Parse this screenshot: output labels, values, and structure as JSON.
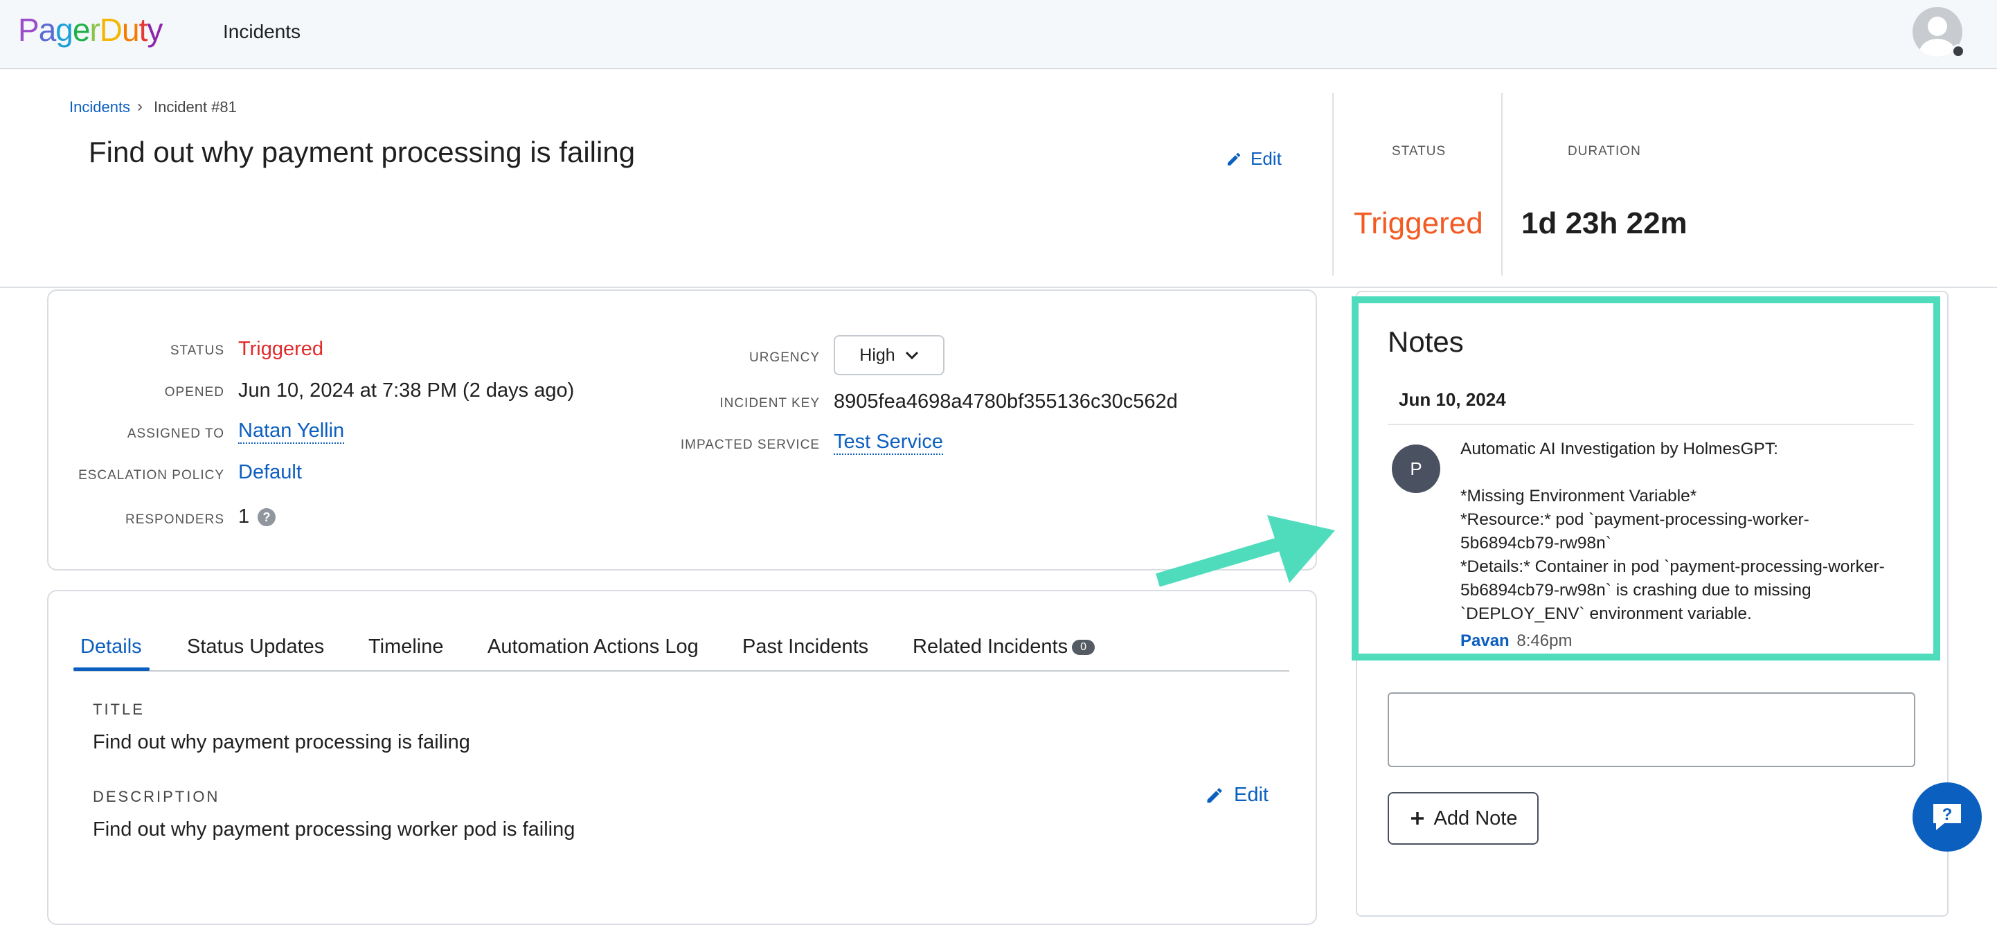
{
  "brand": {
    "letters": [
      "P",
      "a",
      "g",
      "e",
      "r",
      "D",
      "u",
      "t",
      "y"
    ],
    "letter_colors": [
      "#9b4dca",
      "#5b6bd1",
      "#1d9fd8",
      "#21b14b",
      "#8bc34a",
      "#f2b705",
      "#f57c00",
      "#e53935",
      "#8e24aa"
    ]
  },
  "nav": {
    "incidents_label": "Incidents"
  },
  "breadcrumb": {
    "root": "Incidents",
    "separator": "›",
    "current": "Incident #81"
  },
  "header": {
    "title": "Find out why payment processing is failing",
    "edit_label": "Edit",
    "status_label": "STATUS",
    "status_value": "Triggered",
    "duration_label": "DURATION",
    "duration_value": "1d 23h 22m"
  },
  "details": {
    "status_label": "STATUS",
    "status_value": "Triggered",
    "opened_label": "OPENED",
    "opened_value": "Jun 10, 2024 at 7:38 PM (2 days ago)",
    "assigned_label": "ASSIGNED TO",
    "assigned_value": "Natan Yellin",
    "escalation_label": "ESCALATION POLICY",
    "escalation_value": "Default",
    "responders_label": "RESPONDERS",
    "responders_value": "1",
    "urgency_label": "URGENCY",
    "urgency_value": "High",
    "key_label": "INCIDENT KEY",
    "key_value": "8905fea4698a4780bf355136c30c562d",
    "service_label": "IMPACTED SERVICE",
    "service_value": "Test Service"
  },
  "tabs": [
    {
      "label": "Details"
    },
    {
      "label": "Status Updates"
    },
    {
      "label": "Timeline"
    },
    {
      "label": "Automation Actions Log"
    },
    {
      "label": "Past Incidents"
    },
    {
      "label": "Related Incidents",
      "count": "0"
    }
  ],
  "content": {
    "title_label": "TITLE",
    "title_value": "Find out why payment processing is failing",
    "description_label": "DESCRIPTION",
    "description_value": "Find out why payment processing worker pod is failing",
    "edit_label": "Edit"
  },
  "notes": {
    "heading": "Notes",
    "date": "Jun 10, 2024",
    "avatar_initial": "P",
    "text": "Automatic AI Investigation by HolmesGPT:\n\n*Missing Environment Variable*\n*Resource:* pod `payment-processing-worker-\n5b6894cb79-rw98n`\n*Details:* Container in pod `payment-processing-worker-\n5b6894cb79-rw98n` is crashing due to missing\n`DEPLOY_ENV` environment variable.",
    "author": "Pavan",
    "time": "8:46pm",
    "add_label": "Add Note"
  },
  "colors": {
    "accent": "#0b5fbf",
    "triggered_header": "#f15a22",
    "triggered_detail": "#e02b2b",
    "highlight": "#4fdcbd"
  }
}
